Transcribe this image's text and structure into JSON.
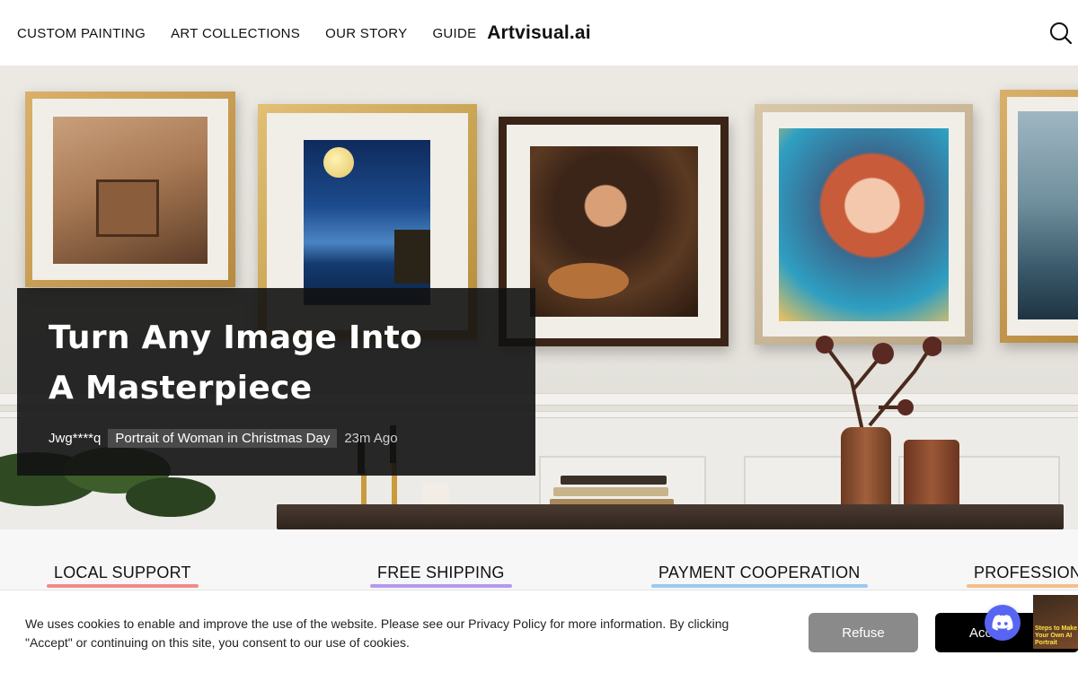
{
  "nav": {
    "items": [
      "CUSTOM PAINTING",
      "ART COLLECTIONS",
      "OUR STORY",
      "GUIDE"
    ]
  },
  "brand": {
    "name": "Artvisual.ai"
  },
  "hero": {
    "title_line1": "Turn Any Image Into",
    "title_line2": "A Masterpiece",
    "activity": {
      "user": "Jwg****q",
      "artwork": "Portrait of Woman in Christmas Day",
      "time": "23m Ago"
    }
  },
  "features": [
    {
      "label": "LOCAL SUPPORT",
      "color": "#f28b8b"
    },
    {
      "label": "FREE SHIPPING",
      "color": "#b39af0"
    },
    {
      "label": "PAYMENT COOPERATION",
      "color": "#9cc9f2"
    },
    {
      "label": "PROFESSIONA",
      "color": "#f4bf8a"
    }
  ],
  "cookie": {
    "text": "We uses cookies to enable and improve the use of the website. Please see our Privacy Policy for more information. By clicking \"Accept\" or continuing on this site, you consent to our use of cookies.",
    "refuse_label": "Refuse",
    "accept_label": "Acc"
  },
  "promo": {
    "text": "Steps to Make Your Own AI Portrait"
  },
  "icons": {
    "search": "search-icon",
    "discord": "discord-icon"
  },
  "colors": {
    "caption_bg": "#121212",
    "refuse_bg": "#8a8a8a",
    "accept_bg": "#000000",
    "discord": "#5865f2"
  }
}
